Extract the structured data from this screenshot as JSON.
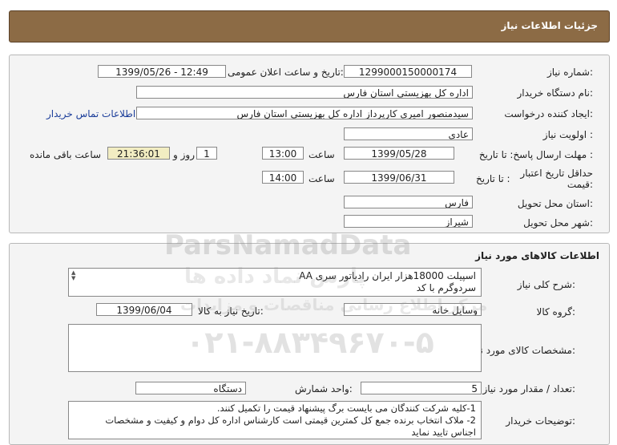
{
  "header": {
    "title": "جزئیات اطلاعات نیاز"
  },
  "details": {
    "need_number_label": "شماره نیاز:",
    "need_number": "1299000150000174",
    "announce_label": "تاریخ و ساعت اعلان عمومی:",
    "announce_value": "1399/05/26 - 12:49",
    "buyer_org_label": "نام دستگاه خریدار:",
    "buyer_org": "اداره کل بهزیستی استان فارس",
    "requester_label": "ایجاد کننده درخواست:",
    "requester": "سیدمنصور امیری کارپرداز اداره کل بهزیستی استان فارس",
    "contact_link": "اطلاعات تماس خریدار",
    "priority_label": "اولویت نیاز :",
    "priority": "عادی",
    "deadline_label": "مهلت ارسال پاسخ: تا تاریخ :",
    "deadline_date": "1399/05/28",
    "time_label": "ساعت",
    "deadline_time": "13:00",
    "days_value": "1",
    "days_label": "روز و",
    "remaining_time": "21:36:01",
    "remaining_label": "ساعت باقی مانده",
    "validity_label_1": "حداقل تاریخ اعتبار",
    "validity_label_2": "قیمت:",
    "validity_to_label": "تا تاریخ :",
    "validity_date": "1399/06/31",
    "validity_time": "14:00",
    "province_label": "استان محل تحویل:",
    "province": "فارس",
    "city_label": "شهر محل تحویل:",
    "city": "شیراز"
  },
  "goods": {
    "section_title": "اطلاعات کالاهای مورد نیاز",
    "summary_label": "شرح کلی نیاز:",
    "summary_line1": "اسپیلت 18000هزار ایران رادیاتور سری AA",
    "summary_line2": "سردوگرم با کد",
    "group_label": "گروه کالا:",
    "group": "وسایل خانه",
    "need_date_label": "تاریخ نیاز به کالا:",
    "need_date": "1399/06/04",
    "specs_label": "مشخصات کالای مورد نیاز:",
    "specs": "",
    "qty_label": "تعداد / مقدار مورد نیاز:",
    "qty": "5",
    "unit_label": "واحد شمارش:",
    "unit": "دستگاه",
    "buyer_notes_label": "توضیحات خریدار:",
    "notes_line1": "1-کلیه شرکت کنندگان می بایست برگ پیشنهاد قیمت را تکمیل کنند.",
    "notes_line2": "2- ملاک انتخاب برنده جمع کل کمترین قیمتی است کارشناس اداره کل  دوام و کیفیت و مشخصات",
    "notes_line3": "اجناس تایید نماید"
  },
  "watermark": {
    "brand": "ParsNamadData",
    "persian": "پارس نماد داده ها",
    "persian2": "مرکز اطلاع رسانی مناقصات و مزایدات",
    "phone": "۰۲۱-۸۸۳۴۹۶۷۰-۵"
  }
}
